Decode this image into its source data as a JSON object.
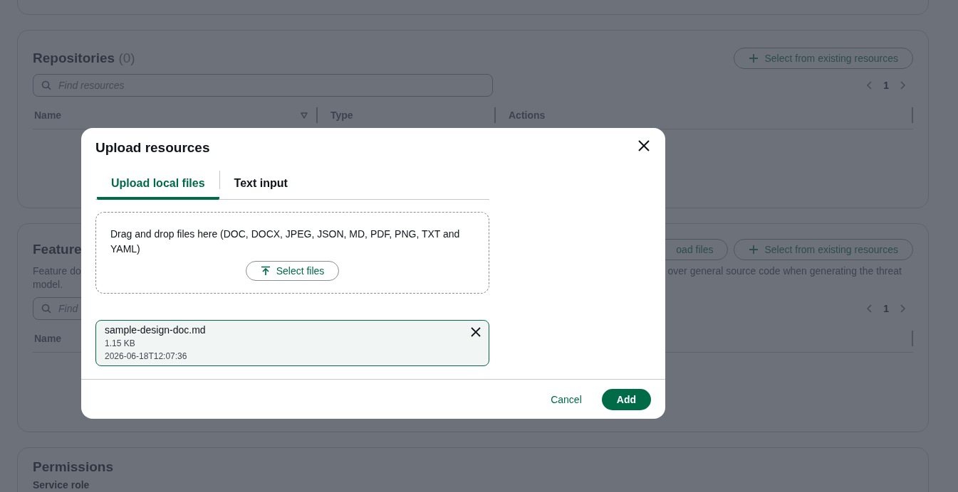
{
  "repositories": {
    "title": "Repositories",
    "count": "(0)",
    "add_button": "Select from existing resources",
    "search": {
      "placeholder": "Find resources"
    },
    "page": "1",
    "columns": [
      "Name",
      "Type",
      "Actions"
    ]
  },
  "features": {
    "title": "Feature",
    "upload_button": "oad files",
    "add_button": "Select from existing resources",
    "description_left": "Feature do",
    "description_right": "over general source code when generating the threat",
    "description_line2": "model.",
    "search": {
      "placeholder": "Find"
    },
    "page": "1",
    "columns": [
      "Name"
    ]
  },
  "permissions": {
    "title": "Permissions",
    "field_label": "Service role"
  },
  "dialog": {
    "title": "Upload resources",
    "tabs": [
      {
        "label": "Upload local files",
        "selected": true
      },
      {
        "label": "Text input",
        "selected": false
      }
    ],
    "dropzone": {
      "text": "Drag and drop files here (DOC, DOCX, JPEG, JSON, MD, PDF, PNG, TXT and YAML)",
      "button": "Select files"
    },
    "files": [
      {
        "name": "sample-design-doc.md",
        "size": "1.15 KB",
        "modified": "2026-06-18T12:07:36"
      }
    ],
    "buttons": [
      {
        "label": "Cancel",
        "kind": "link"
      },
      {
        "label": "Add",
        "kind": "primary"
      }
    ]
  }
}
